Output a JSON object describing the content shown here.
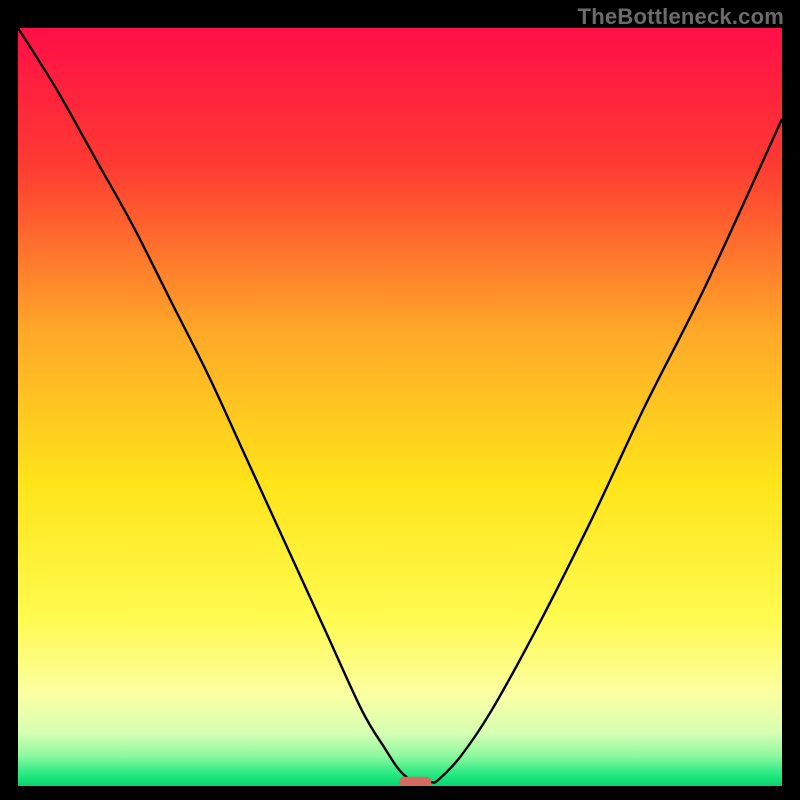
{
  "watermark": "TheBottleneck.com",
  "chart_data": {
    "type": "line",
    "title": "",
    "xlabel": "",
    "ylabel": "",
    "xlim": [
      0,
      100
    ],
    "ylim": [
      0,
      100
    ],
    "grid": false,
    "legend": false,
    "background": {
      "type": "vertical-gradient",
      "stops": [
        {
          "offset": 0.0,
          "color": "#ff0f47"
        },
        {
          "offset": 0.18,
          "color": "#ff3a32"
        },
        {
          "offset": 0.4,
          "color": "#ffa828"
        },
        {
          "offset": 0.6,
          "color": "#ffe41a"
        },
        {
          "offset": 0.78,
          "color": "#fffb50"
        },
        {
          "offset": 0.88,
          "color": "#fbffa3"
        },
        {
          "offset": 0.93,
          "color": "#d6ffb3"
        },
        {
          "offset": 0.96,
          "color": "#8ef8a0"
        },
        {
          "offset": 0.985,
          "color": "#24e981"
        },
        {
          "offset": 1.0,
          "color": "#07d66d"
        }
      ]
    },
    "series": [
      {
        "name": "bottleneck-curve",
        "color": "#000000",
        "x": [
          0,
          5,
          10,
          15,
          20,
          25,
          30,
          35,
          40,
          45,
          48,
          50,
          52,
          54,
          55,
          58,
          62,
          68,
          75,
          82,
          90,
          100
        ],
        "y": [
          100,
          92,
          83,
          74,
          64,
          54,
          43,
          32,
          21,
          10,
          5,
          2,
          0.5,
          0.5,
          0.8,
          4,
          10,
          21,
          35,
          50,
          66,
          88
        ]
      }
    ],
    "marker": {
      "name": "optimal-point",
      "shape": "capsule",
      "x": 52,
      "y": 0.5,
      "color": "#d46b63"
    }
  }
}
